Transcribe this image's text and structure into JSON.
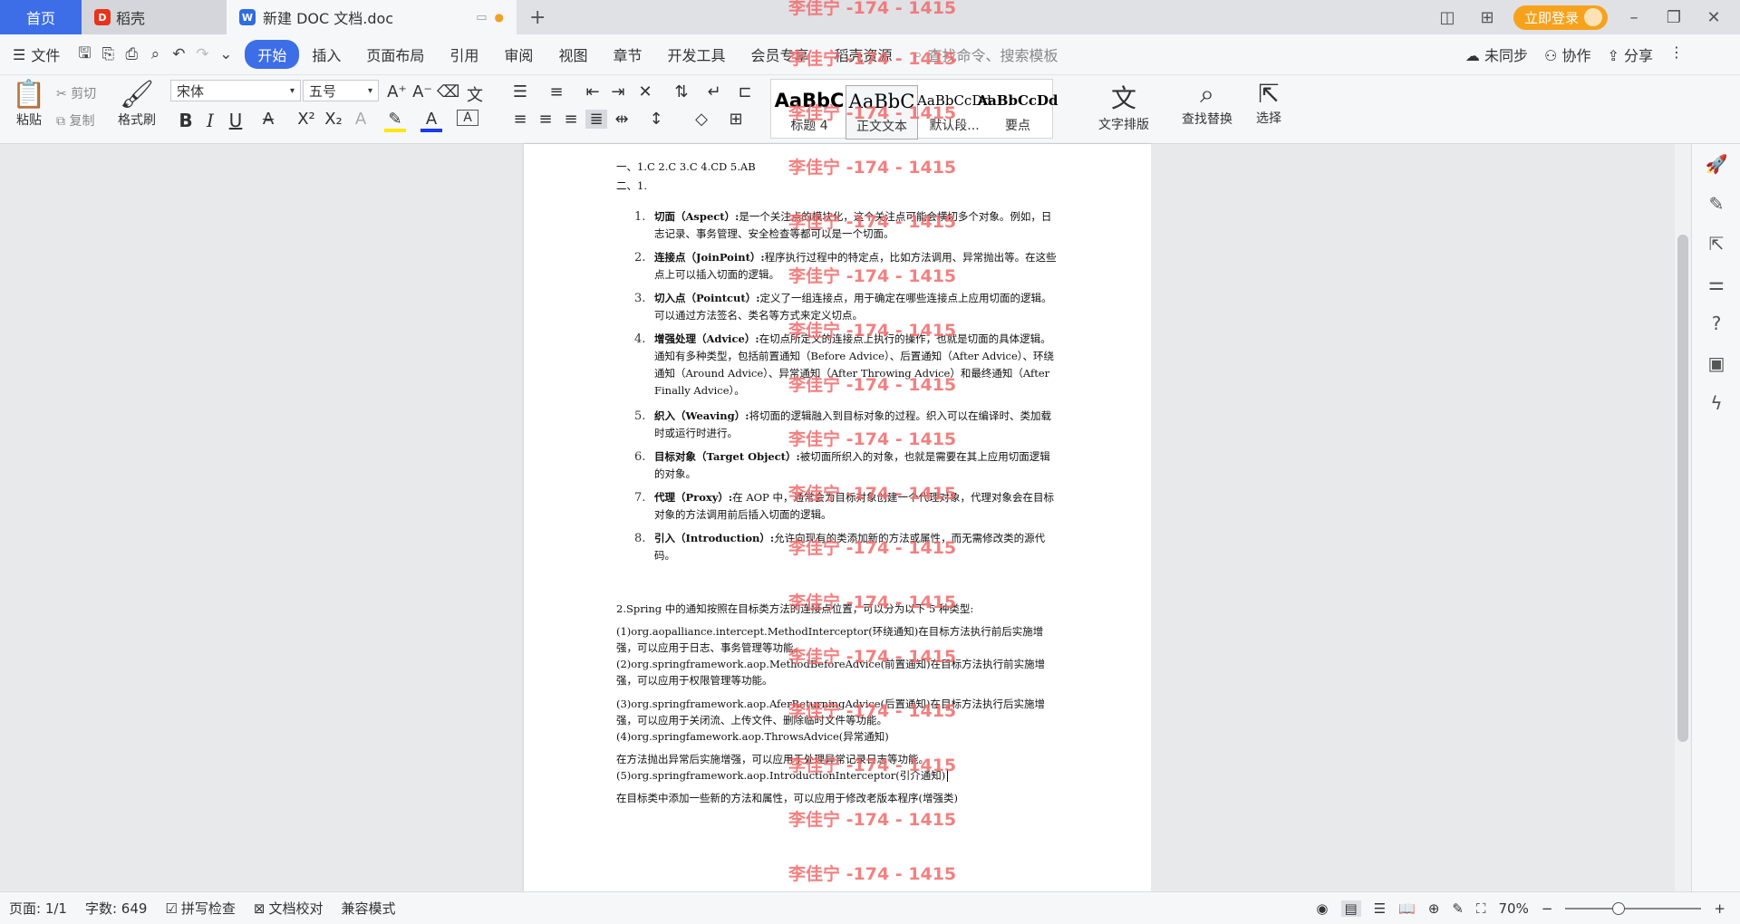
{
  "tabs": {
    "home": "首页",
    "docer": "稻壳",
    "doc": "新建 DOC 文档.doc",
    "add": "+"
  },
  "titlebar": {
    "login": "立即登录"
  },
  "menu": {
    "file": "文件",
    "items": [
      "开始",
      "插入",
      "页面布局",
      "引用",
      "审阅",
      "视图",
      "章节",
      "开发工具",
      "会员专享",
      "稻壳资源"
    ],
    "search": "查找命令、搜索模板",
    "unsynced": "未同步",
    "collab": "协作",
    "share": "分享"
  },
  "ribbon": {
    "paste": "粘贴",
    "cut": "剪切",
    "copy": "复制",
    "format_painter": "格式刷",
    "font_name": "宋体",
    "font_size": "五号",
    "styles": [
      {
        "sample": "AaBbC",
        "label": "标题 4"
      },
      {
        "sample": "AaBbC",
        "label": "正文文本"
      },
      {
        "sample": "AaBbCcDd",
        "label": "默认段..."
      },
      {
        "sample": "AaBbCcDd",
        "label": "要点"
      }
    ],
    "text_layout": "文字排版",
    "find_replace": "查找替换",
    "select": "选择"
  },
  "watermark": "李佳宁 -174 - 1415",
  "doc": {
    "line1": "一、1.C 2.C 3.C 4.CD 5.AB",
    "line2": "二、1.",
    "items": [
      {
        "n": "1.",
        "term": "切面（Aspect）:",
        "text": "是一个关注点的模块化，这个关注点可能会横切多个对象。例如，日志记录、事务管理、安全检查等都可以是一个切面。"
      },
      {
        "n": "2.",
        "term": "连接点（JoinPoint）:",
        "text": "程序执行过程中的特定点，比如方法调用、异常抛出等。在这些点上可以插入切面的逻辑。"
      },
      {
        "n": "3.",
        "term": "切入点（Pointcut）:",
        "text": "定义了一组连接点，用于确定在哪些连接点上应用切面的逻辑。可以通过方法签名、类名等方式来定义切点。"
      },
      {
        "n": "4.",
        "term": "增强处理（Advice）:",
        "text": "在切点所定义的连接点上执行的操作，也就是切面的具体逻辑。通知有多种类型，包括前置通知（Before Advice）、后置通知（After Advice）、环绕通知（Around Advice）、异常通知（After Throwing Advice）和最终通知（After Finally Advice）。"
      },
      {
        "n": "5.",
        "term": "织入（Weaving）:",
        "text": "将切面的逻辑融入到目标对象的过程。织入可以在编译时、类加载时或运行时进行。"
      },
      {
        "n": "6.",
        "term": "目标对象（Target Object）:",
        "text": "被切面所织入的对象，也就是需要在其上应用切面逻辑的对象。"
      },
      {
        "n": "7.",
        "term": "代理（Proxy）:",
        "text": "在 AOP 中，通常会为目标对象创建一个代理对象，代理对象会在目标对象的方法调用前后插入切面的逻辑。"
      },
      {
        "n": "8.",
        "term": "引入（Introduction）:",
        "text": "允许向现有的类添加新的方法或属性，而无需修改类的源代码。"
      }
    ],
    "p2_title": "2.Spring 中的通知按照在目标类方法的连接点位置，可以分为以下 5 种类型:",
    "p2_1a": "(1)org.aopalliance.intercept.MethodInterceptor(环绕通知)在目标方法执行前后实施增强，可以应用于日志、事务管理等功能。",
    "p2_2": "(2)org.springframework.aop.MethodBeforeAdvice(前置通知)在目标方法执行前实施增强，可以应用于权限管理等功能。",
    "p2_3": "(3)org.springframework.aop.AferReturningAdvice(后置通知)在目标方法执行后实施增强，可以应用于关闭流、上传文件、删除临时文件等功能。",
    "p2_4": "(4)org.springfamework.aop.ThrowsAdvice(异常通知)",
    "p2_4b": "在方法抛出异常后实施增强，可以应用于处理异常记录日志等功能。",
    "p2_5": "(5)org.springframework.aop.IntroductionInterceptor(引介通知)",
    "p2_5b": "在目标类中添加一些新的方法和属性，可以应用于修改老版本程序(增强类)"
  },
  "status": {
    "page": "页面: 1/1",
    "words": "字数: 649",
    "spell": "拼写检查",
    "proof": "文档校对",
    "compat": "兼容模式",
    "zoom": "70%"
  }
}
